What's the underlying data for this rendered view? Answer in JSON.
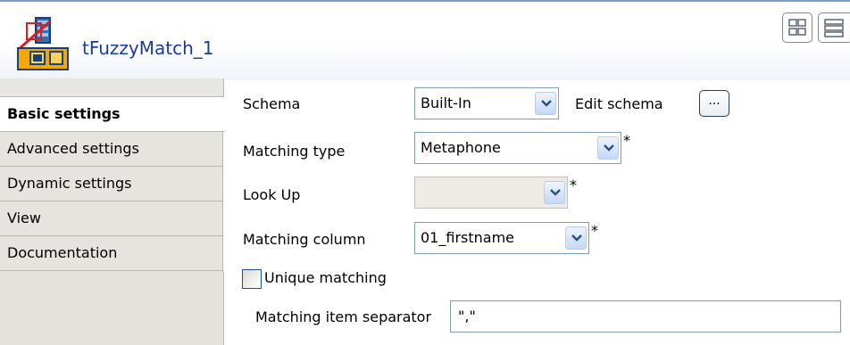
{
  "header": {
    "title": "tFuzzyMatch_1",
    "component_icon": "fuzzy-match-component-icon",
    "view_buttons": [
      "table-view-icon",
      "list-view-icon"
    ]
  },
  "tabs": [
    {
      "label": "Basic settings",
      "active": true
    },
    {
      "label": "Advanced settings",
      "active": false
    },
    {
      "label": "Dynamic settings",
      "active": false
    },
    {
      "label": "View",
      "active": false
    },
    {
      "label": "Documentation",
      "active": false
    }
  ],
  "form": {
    "schema": {
      "label": "Schema",
      "value": "Built-In",
      "edit_label": "Edit schema",
      "edit_button": "..."
    },
    "matching_type": {
      "label": "Matching type",
      "value": "Metaphone",
      "required": "*"
    },
    "look_up": {
      "label": "Look Up",
      "value": "",
      "required": "*"
    },
    "matching_column": {
      "label": "Matching column",
      "value": "01_firstname",
      "required": "*"
    },
    "unique_matching": {
      "label": "Unique matching",
      "checked": false
    },
    "separator": {
      "label": "Matching item separator",
      "value": "\",\""
    }
  },
  "colors": {
    "title": "#1c3c9a",
    "tab_bg": "#e6e4de",
    "combo_border": "#7f9db9"
  }
}
